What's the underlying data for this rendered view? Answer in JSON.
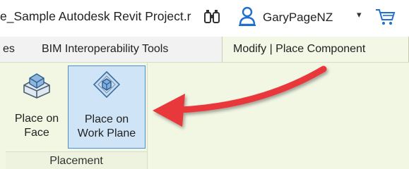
{
  "titlebar": {
    "project_title": "e_Sample Autodesk Revit Project.r",
    "binoculars_icon": "binoculars-icon",
    "user_icon": "user-icon",
    "user_name": "GaryPageNZ",
    "user_caret": "▾",
    "cart_icon": "cart-icon"
  },
  "tabs": [
    {
      "label": "es"
    },
    {
      "label": "BIM Interoperability Tools"
    },
    {
      "label": "Modify | Place Component",
      "active": true
    }
  ],
  "ribbon": {
    "buttons": [
      {
        "label": "Place on\nFace",
        "icon": "place-on-face-icon",
        "selected": false
      },
      {
        "label": "Place on\nWork Plane",
        "icon": "place-on-work-plane-icon",
        "selected": true
      }
    ],
    "panel_title": "Placement"
  },
  "colors": {
    "ribbon_bg": "#f2f7e4",
    "selected_bg": "#cfe4f6",
    "selected_border": "#4a8ed4",
    "arrow": "#e8373a",
    "user_blue": "#1f6fd1"
  }
}
